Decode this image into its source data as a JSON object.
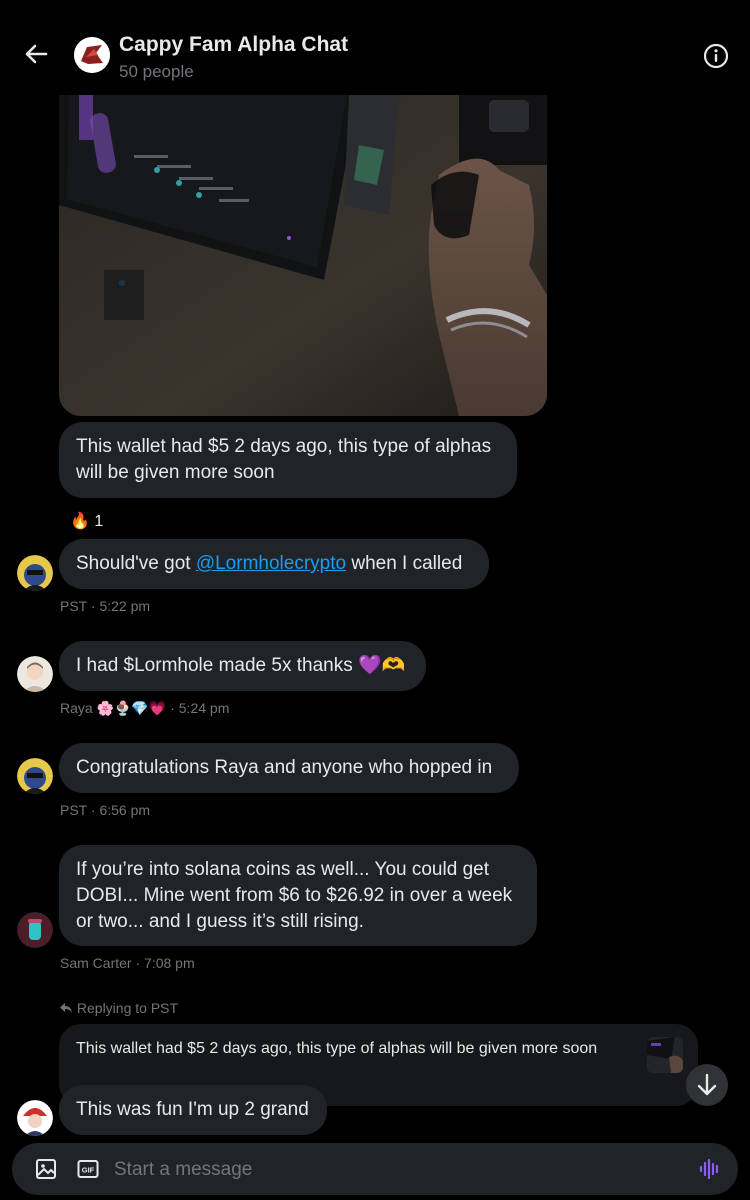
{
  "header": {
    "title": "Cappy Fam Alpha Chat",
    "subtitle": "50 people"
  },
  "messages": [
    {
      "text": "This wallet had $5 2 days ago, this type of alphas will be given more soon",
      "reaction": {
        "emoji": "🔥",
        "count": "1"
      }
    },
    {
      "text_before": "Should've got ",
      "mention": "@Lormholecrypto",
      "text_after": " when I called",
      "sender": "PST",
      "time": "5:22 pm"
    },
    {
      "text": "I had $Lormhole made 5x thanks 💜🫶",
      "sender": "Raya 🌸🍨💎💗",
      "time": "5:24 pm"
    },
    {
      "text": "Congratulations Raya and anyone who hopped in",
      "sender": "PST",
      "time": "6:56 pm"
    },
    {
      "text": "If you’re into solana coins as well... You could get DOBI... Mine went from $6 to $26.92 in over a week or two... and I guess it’s still rising.",
      "sender": "Sam Carter",
      "time": "7:08 pm"
    }
  ],
  "reply": {
    "note": "Replying to PST",
    "quoted_text": "This wallet had $5 2 days ago, this type of alphas will be given more soon",
    "text": "This was fun I'm up 2 grand"
  },
  "composer": {
    "placeholder": "Start a message"
  },
  "colors": {
    "background": "#000000",
    "bubble": "#202327",
    "link": "#1d9bf0",
    "muted": "#71767b",
    "voice_accent": "#8b5cf6"
  },
  "icons": [
    "back-arrow-icon",
    "info-icon",
    "image-icon",
    "gif-icon",
    "voice-icon",
    "arrow-down-icon",
    "reply-arrow-icon"
  ]
}
